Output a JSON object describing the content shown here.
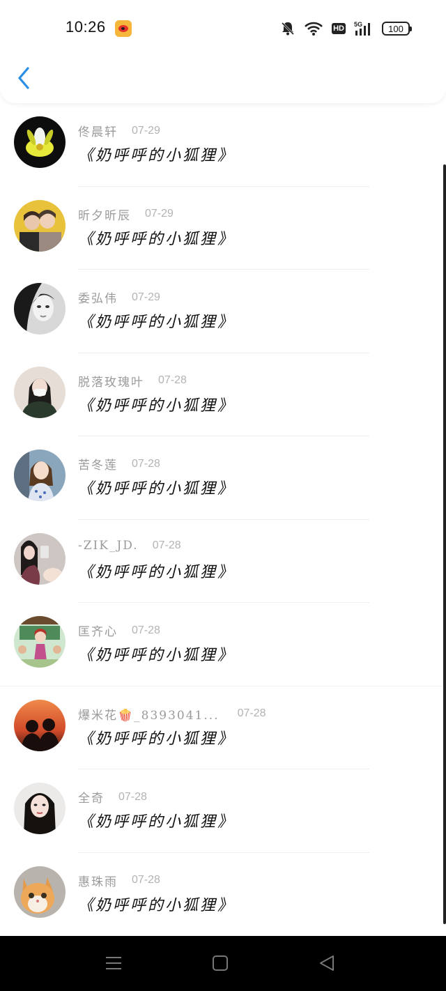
{
  "status": {
    "time": "10:26",
    "hd": "HD",
    "network": "5G",
    "battery": "100"
  },
  "header": {
    "back_icon": "chevron-left-icon"
  },
  "items": [
    {
      "name": "佟晨轩",
      "date": "07-29",
      "title": "《奶呼呼的小狐狸》",
      "avatar": "flower"
    },
    {
      "name": "昕夕昕辰",
      "date": "07-29",
      "title": "《奶呼呼的小狐狸》",
      "avatar": "couple"
    },
    {
      "name": "委弘伟",
      "date": "07-29",
      "title": "《奶呼呼的小狐狸》",
      "avatar": "bw-woman"
    },
    {
      "name": "脱落玫瑰叶",
      "date": "07-28",
      "title": "《奶呼呼的小狐狸》",
      "avatar": "masked-girl"
    },
    {
      "name": "苦冬莲",
      "date": "07-28",
      "title": "《奶呼呼的小狐狸》",
      "avatar": "child"
    },
    {
      "name": "-ZIK_JD.",
      "date": "07-28",
      "title": "《奶呼呼的小狐狸》",
      "avatar": "selfie"
    },
    {
      "name": "匡齐心",
      "date": "07-28",
      "title": "《奶呼呼的小狐狸》",
      "avatar": "cartoon"
    },
    {
      "name": "爆米花🍿_8393041...",
      "date": "07-28",
      "title": "《奶呼呼的小狐狸》",
      "avatar": "sunset"
    },
    {
      "name": "全奇",
      "date": "07-28",
      "title": "《奶呼呼的小狐狸》",
      "avatar": "woman"
    },
    {
      "name": "惠珠雨",
      "date": "07-28",
      "title": "《奶呼呼的小狐狸》",
      "avatar": "cat"
    }
  ],
  "navbar": {
    "icons": [
      "menu-icon",
      "home-icon",
      "back-triangle-icon"
    ]
  },
  "colors": {
    "accent": "#2a8ee6",
    "meta": "#9a9a9a",
    "nav": "#000000"
  }
}
